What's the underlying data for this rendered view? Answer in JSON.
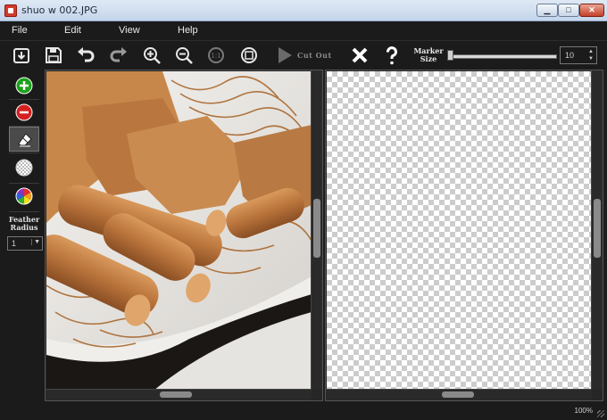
{
  "window": {
    "title": "shuo w 002.JPG",
    "min_glyph": "▁",
    "max_glyph": "□",
    "close_glyph": "✕"
  },
  "menu": [
    "File",
    "Edit",
    "View",
    "Help"
  ],
  "toolbar": {
    "icons": [
      "open-file-icon",
      "save-icon",
      "undo-icon",
      "redo-icon",
      "zoom-in-icon",
      "zoom-out-icon",
      "actual-size-icon",
      "fit-to-window-icon",
      "play-icon",
      "clear-icon",
      "help-icon"
    ],
    "cut_out_label": "Cut Out",
    "marker_size_label": "Marker Size",
    "marker_size_value": "10",
    "spin_up": "▲",
    "spin_down": "▼"
  },
  "tools": {
    "icons": [
      "add-area-icon",
      "remove-area-icon",
      "eraser-icon",
      "mask-icon",
      "color-wheel-icon"
    ],
    "selected": "eraser-icon",
    "feather_radius_label": "Feather Radius",
    "feather_radius_value": "1",
    "feather_arrow": "▼"
  },
  "colors": {
    "background": "#1b1b1b",
    "add": "#1aa31a",
    "remove": "#d42020",
    "accent_border": "#555555"
  },
  "status": {
    "zoom": "100%"
  }
}
